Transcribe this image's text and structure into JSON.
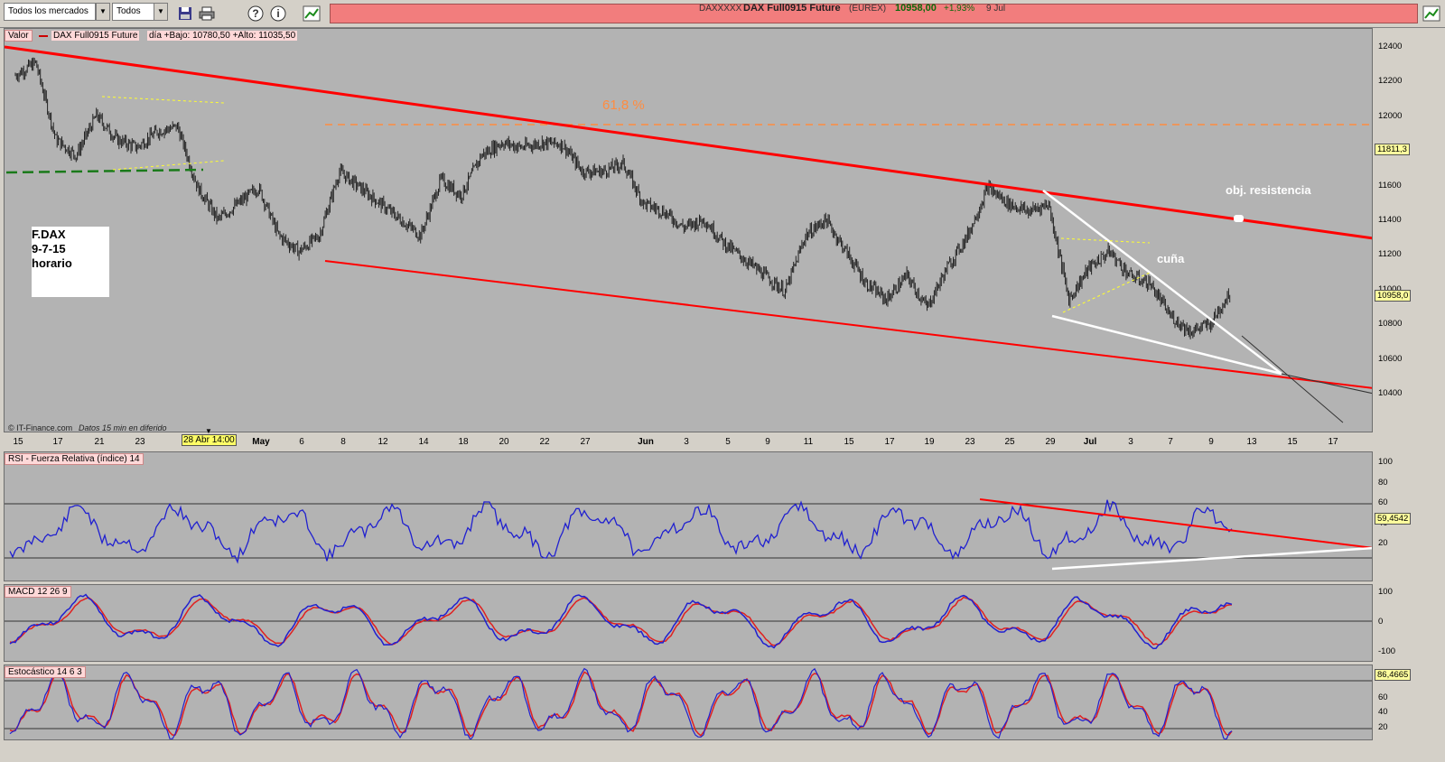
{
  "toolbar": {
    "market_filter": "Todos los mercados",
    "type_filter": "Todos"
  },
  "ticker": {
    "code": "DAXXXXX",
    "name": "DAX Full0915 Future",
    "exchange": "(EUREX)",
    "price": "10958,00",
    "change": "+1,93%",
    "date": "9 Jul"
  },
  "price_pane": {
    "legend_label": "Valor",
    "series_name": "DAX Full0915 Future",
    "range_text": "día +Bajo: 10780,50 +Alto: 11035,50",
    "fib_label": "61,8 %",
    "resistance_label": "obj. resistencia",
    "wedge_label": "cuña",
    "note_lines": [
      "F.DAX",
      "9-7-15",
      "horario"
    ],
    "source_text": "IT-Finance.com",
    "delay_text": "Datos 15 min en diferido",
    "y_ticks": [
      "12400",
      "12200",
      "12000",
      "11800",
      "11600",
      "11400",
      "11200",
      "11000",
      "10800",
      "10600",
      "10400"
    ],
    "y_box_upper": "11811,3",
    "y_box_price": "10958,0",
    "x_labels": [
      {
        "t": "15",
        "m": false
      },
      {
        "t": "17",
        "m": false
      },
      {
        "t": "21",
        "m": false
      },
      {
        "t": "23",
        "m": false
      },
      {
        "t": "2",
        "m": false
      },
      {
        "t": "May",
        "m": true
      },
      {
        "t": "6",
        "m": false
      },
      {
        "t": "8",
        "m": false
      },
      {
        "t": "12",
        "m": false
      },
      {
        "t": "14",
        "m": false
      },
      {
        "t": "18",
        "m": false
      },
      {
        "t": "20",
        "m": false
      },
      {
        "t": "22",
        "m": false
      },
      {
        "t": "27",
        "m": false
      },
      {
        "t": "Jun",
        "m": true
      },
      {
        "t": "3",
        "m": false
      },
      {
        "t": "5",
        "m": false
      },
      {
        "t": "9",
        "m": false
      },
      {
        "t": "11",
        "m": false
      },
      {
        "t": "15",
        "m": false
      },
      {
        "t": "17",
        "m": false
      },
      {
        "t": "19",
        "m": false
      },
      {
        "t": "23",
        "m": false
      },
      {
        "t": "25",
        "m": false
      },
      {
        "t": "29",
        "m": false
      },
      {
        "t": "Jul",
        "m": true
      },
      {
        "t": "3",
        "m": false
      },
      {
        "t": "7",
        "m": false
      },
      {
        "t": "9",
        "m": false
      },
      {
        "t": "13",
        "m": false
      },
      {
        "t": "15",
        "m": false
      },
      {
        "t": "17",
        "m": false
      }
    ],
    "cursor_date": "28 Abr 14:00"
  },
  "rsi_pane": {
    "label": "RSI - Fuerza Relativa (índice) 14",
    "y_ticks": [
      "100",
      "80",
      "60",
      "40",
      "20"
    ],
    "y_box": "59,4542"
  },
  "macd_pane": {
    "label": "MACD 12 26 9",
    "y_ticks": [
      "100",
      "0",
      "-100"
    ]
  },
  "stoch_pane": {
    "label": "Estocástico 14 6 3",
    "y_ticks": [
      "60",
      "40",
      "20"
    ],
    "y_box": "86,4665"
  },
  "colors": {
    "channel": "#ff0000",
    "fib": "#ff8c40",
    "indicator_blue": "#2020d0",
    "indicator_red": "#e02020",
    "pane_bg": "#b3b3b3"
  },
  "chart_data": {
    "type": "line",
    "title": "DAX Full0915 Future",
    "ylim": [
      10200,
      12500
    ],
    "close_path": [
      [
        "Apr 15",
        12300
      ],
      [
        "Apr 16",
        12380
      ],
      [
        "Apr 17",
        11900
      ],
      [
        "Apr 20",
        11800
      ],
      [
        "Apr 21",
        12050
      ],
      [
        "Apr 22",
        11900
      ],
      [
        "Apr 23",
        11850
      ],
      [
        "Apr 24",
        11950
      ],
      [
        "Apr 27",
        11980
      ],
      [
        "Apr 28",
        11600
      ],
      [
        "Apr 29",
        11400
      ],
      [
        "Apr 30",
        11500
      ],
      [
        "May 4",
        11600
      ],
      [
        "May 5",
        11300
      ],
      [
        "May 6",
        11200
      ],
      [
        "May 7",
        11300
      ],
      [
        "May 8",
        11700
      ],
      [
        "May 11",
        11600
      ],
      [
        "May 12",
        11500
      ],
      [
        "May 13",
        11400
      ],
      [
        "May 14",
        11300
      ],
      [
        "May 15",
        11650
      ],
      [
        "May 18",
        11550
      ],
      [
        "May 19",
        11800
      ],
      [
        "May 20",
        11880
      ],
      [
        "May 21",
        11850
      ],
      [
        "May 22",
        11880
      ],
      [
        "May 25",
        11870
      ],
      [
        "May 26",
        11700
      ],
      [
        "May 27",
        11700
      ],
      [
        "May 28",
        11750
      ],
      [
        "May 29",
        11500
      ],
      [
        "Jun 1",
        11450
      ],
      [
        "Jun 2",
        11350
      ],
      [
        "Jun 3",
        11400
      ],
      [
        "Jun 4",
        11250
      ],
      [
        "Jun 5",
        11150
      ],
      [
        "Jun 8",
        11050
      ],
      [
        "Jun 9",
        10950
      ],
      [
        "Jun 10",
        11300
      ],
      [
        "Jun 11",
        11400
      ],
      [
        "Jun 12",
        11200
      ],
      [
        "Jun 15",
        11000
      ],
      [
        "Jun 16",
        10900
      ],
      [
        "Jun 17",
        11050
      ],
      [
        "Jun 18",
        10850
      ],
      [
        "Jun 19",
        11100
      ],
      [
        "Jun 22",
        11300
      ],
      [
        "Jun 23",
        11600
      ],
      [
        "Jun 24",
        11500
      ],
      [
        "Jun 25",
        11450
      ],
      [
        "Jun 26",
        11500
      ],
      [
        "Jun 29",
        10900
      ],
      [
        "Jun 30",
        11100
      ],
      [
        "Jul 1",
        11200
      ],
      [
        "Jul 2",
        11050
      ],
      [
        "Jul 3",
        11000
      ],
      [
        "Jul 6",
        10800
      ],
      [
        "Jul 7",
        10700
      ],
      [
        "Jul 8",
        10750
      ],
      [
        "Jul 9",
        10958
      ]
    ]
  }
}
